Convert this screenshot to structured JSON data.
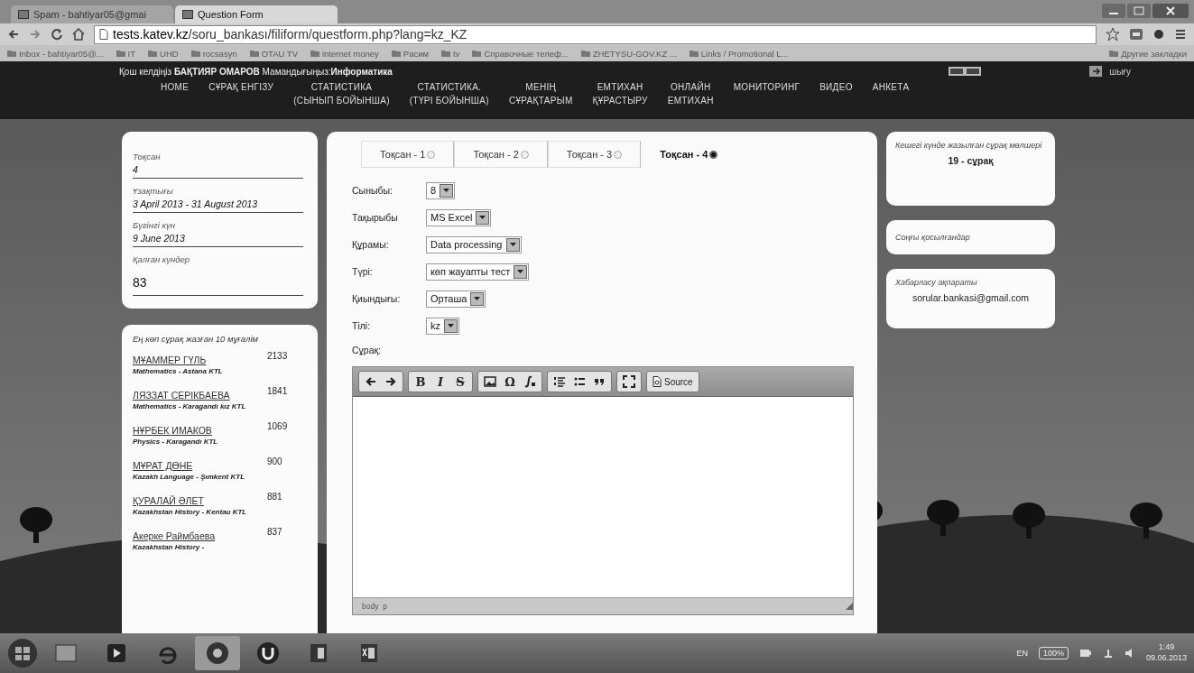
{
  "browser": {
    "tabs": [
      {
        "title": "Spam - bahtiyar05@gmai",
        "selected": false
      },
      {
        "title": "Question Form",
        "selected": true
      }
    ],
    "address": {
      "host": "tests.katev.kz",
      "path": "/soru_bankası/filiform/questform.php?lang=kz_KZ"
    },
    "bookmarks": [
      "Inbox - bahtiyar05@...",
      "IT",
      "UHD",
      "rocsasyn",
      "OTAU TV",
      "internet money",
      "Pacим",
      "tv",
      "Справочные телеф...",
      "ZHETYSU-GOV.KZ ...",
      "Links / Promotional L..."
    ],
    "other_bookmarks": "Другие закладки"
  },
  "site_header": {
    "welcome": "Қош келдіңіз **БАҚТИЯР ОМАРОВ** Мамандығыңыз:**Информатика**",
    "logout": "шығу",
    "nav": [
      "HOME",
      "СҰРАҚ ЕНГІЗУ",
      "СТАТИСТИКА\n(СЫНЫП БОЙЫНША)",
      "СТАТИСТИКА.\n(ТҮРІ БОЙЫНША)",
      "МЕНІҢ\nСҰРАҚТАРЫМ",
      "ЕМТИХАН\nҚҰРАСТЫРУ",
      "ОНЛАЙН\nЕМТИХАН",
      "МОНИТОРИНГ",
      "ВИДЕО",
      "АНКЕТА"
    ]
  },
  "term_card": [
    {
      "label": "Тоқсан",
      "value": "4"
    },
    {
      "label": "Ұзақтығы",
      "value": "3 April 2013 - 31 August 2013"
    },
    {
      "label": "Бүгінгі күн",
      "value": "9 June 2013"
    },
    {
      "label": "Қалған күндер",
      "value": "83"
    }
  ],
  "top_teachers": {
    "title": "Ең көп сұрақ жазған 10 мұғалім",
    "rows": [
      {
        "name": "МҰАММЕР ГҮЛЬ",
        "detail": "Mathematics - Astana KTL",
        "count": "2133"
      },
      {
        "name": "ЛЯЗЗАТ СЕРІКБАЕВА",
        "detail": "Mathematics - Karagandı kız KTL",
        "count": "1841"
      },
      {
        "name": "НҰРБЕК ИМАКОВ",
        "detail": "Physics - Karagandı KTL",
        "count": "1069"
      },
      {
        "name": "МҰРАТ ДӨНЕ",
        "detail": "Kazakh Language - Şımkent KTL",
        "count": "900"
      },
      {
        "name": "ҚУРАЛАЙ ӘЛЕТ",
        "detail": "Kazakhstan History - Kentau KTL",
        "count": "881"
      },
      {
        "name": "Акерке Раймбаева",
        "detail": "Kazakhstan History -",
        "count": "837"
      }
    ]
  },
  "form": {
    "tabs": [
      {
        "label": "Тоқсан - 1",
        "selected": false
      },
      {
        "label": "Тоқсан - 2",
        "selected": false
      },
      {
        "label": "Тоқсан - 3",
        "selected": false
      },
      {
        "label": "Тоқсан - 4",
        "selected": true
      }
    ],
    "fields": [
      {
        "label": "Сыныбы:",
        "value": "8"
      },
      {
        "label": "Тақырыбы",
        "value": "MS Excel"
      },
      {
        "label": "Құрамы:",
        "value": "Data processing"
      },
      {
        "label": "Түрі:",
        "value": "көп жауапты тест"
      },
      {
        "label": "Қиындығы:",
        "value": "Орташа"
      },
      {
        "label": "Тілі:",
        "value": "kz"
      }
    ],
    "question_label": "Сұрақ:",
    "toolbar": [
      [
        {
          "kind": "undo"
        },
        {
          "kind": "redo"
        }
      ],
      [
        {
          "kind": "bold",
          "label": "B"
        },
        {
          "kind": "italic",
          "label": "I"
        },
        {
          "kind": "strike",
          "label": "S"
        }
      ],
      [
        {
          "kind": "image"
        },
        {
          "kind": "glyph",
          "label": "Ω"
        },
        {
          "kind": "formula"
        }
      ],
      [
        {
          "kind": "numbered"
        },
        {
          "kind": "bulleted"
        },
        {
          "kind": "quote"
        }
      ],
      [
        {
          "kind": "maximize"
        }
      ],
      [
        {
          "kind": "source",
          "label": "Source"
        }
      ]
    ],
    "editor_path": "body  p"
  },
  "side": {
    "yesterday_title": "Кешегі күнде жазылған сұрақ мөлшері",
    "yesterday_value": "19 - сұрақ",
    "recent_title": "Соңғы қосылғандар",
    "contact_title": "Хабарласу ақпараты",
    "contact_email": "sorular.bankasi@gmail.com"
  },
  "taskbar": {
    "language": "EN",
    "zoom": "100%",
    "time": "1:49",
    "date": "09.06.2013"
  }
}
